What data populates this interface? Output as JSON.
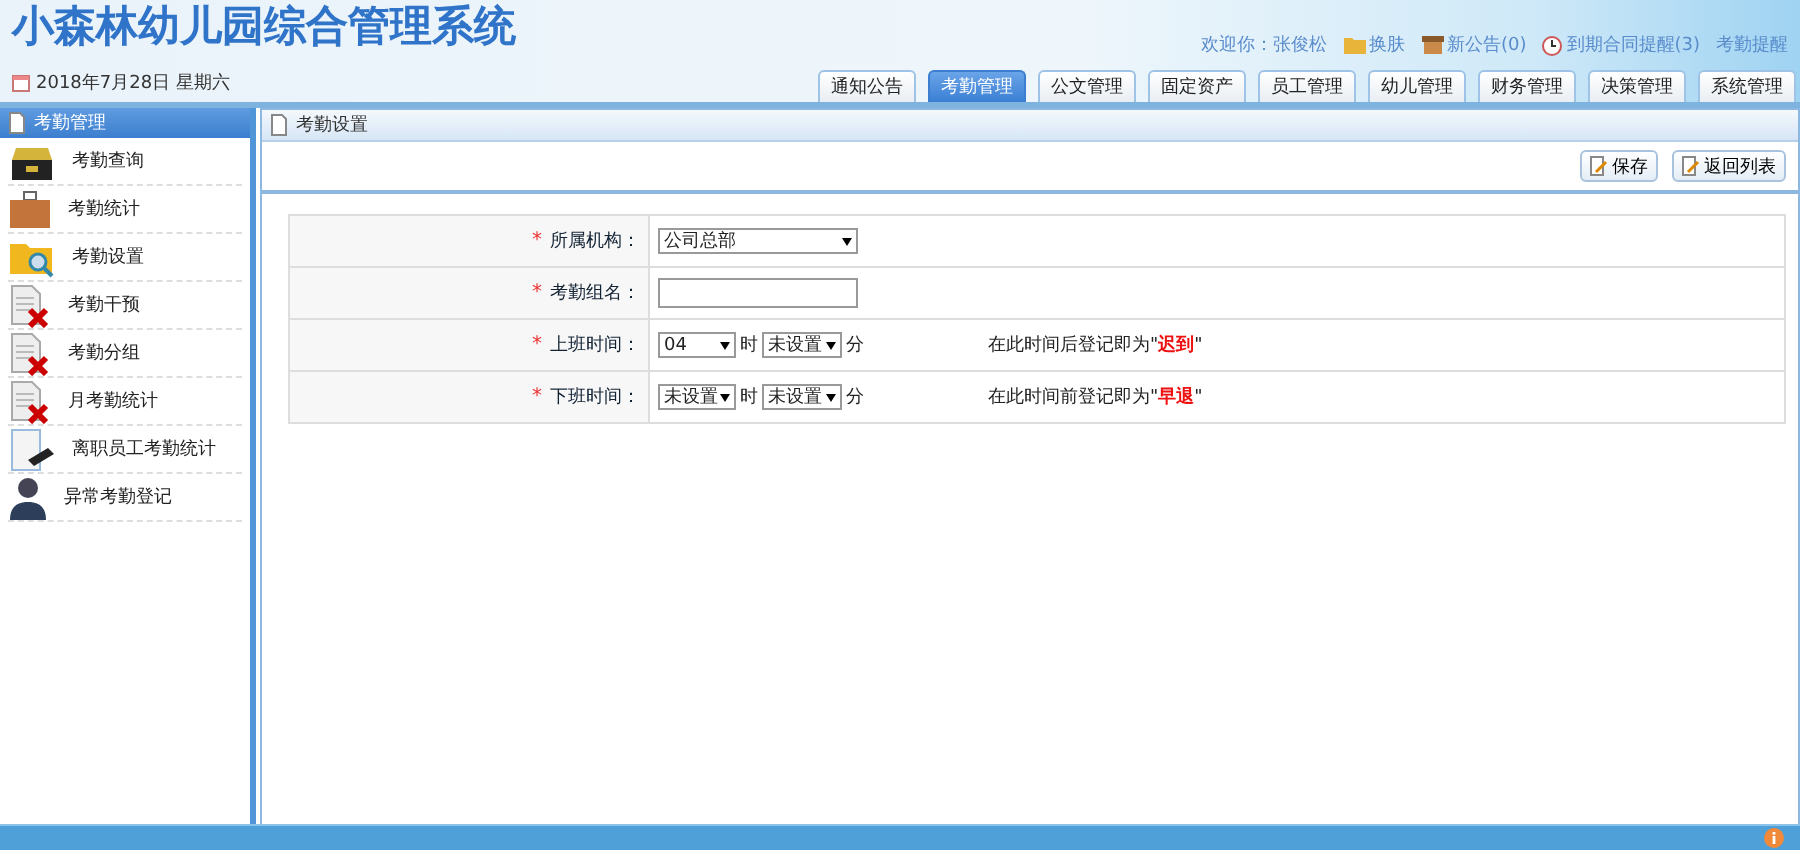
{
  "header": {
    "title": "小森林幼儿园综合管理系统",
    "date": "2018年7月28日 星期六",
    "welcome": "欢迎你：张俊松",
    "links": [
      {
        "kind": "skin",
        "label": "换肤"
      },
      {
        "kind": "notice",
        "label": "新公告(0)"
      },
      {
        "kind": "clock",
        "label": "到期合同提醒(3)"
      },
      {
        "kind": "plain",
        "label": "考勤提醒"
      }
    ]
  },
  "tabs": [
    {
      "label": "通知公告",
      "selected": false
    },
    {
      "label": "考勤管理",
      "selected": true
    },
    {
      "label": "公文管理",
      "selected": false
    },
    {
      "label": "固定资产",
      "selected": false
    },
    {
      "label": "员工管理",
      "selected": false
    },
    {
      "label": "幼儿管理",
      "selected": false
    },
    {
      "label": "财务管理",
      "selected": false
    },
    {
      "label": "决策管理",
      "selected": false
    },
    {
      "label": "系统管理",
      "selected": false
    }
  ],
  "sidebar": {
    "title": "考勤管理",
    "items": [
      {
        "kind": "drawer",
        "label": "考勤查询"
      },
      {
        "kind": "briefcase",
        "label": "考勤统计"
      },
      {
        "kind": "folder",
        "label": "考勤设置"
      },
      {
        "kind": "docx",
        "label": "考勤干预"
      },
      {
        "kind": "docx",
        "label": "考勤分组"
      },
      {
        "kind": "docx",
        "label": "月考勤统计"
      },
      {
        "kind": "docpen",
        "label": "离职员工考勤统计"
      },
      {
        "kind": "person",
        "label": "异常考勤登记"
      }
    ]
  },
  "panel": {
    "title": "考勤设置",
    "buttons": [
      "保存",
      "返回列表"
    ],
    "rows": [
      {
        "kind": "select",
        "required": "*",
        "label": "所属机构：",
        "value": "公司总部"
      },
      {
        "kind": "text",
        "required": "*",
        "label": "考勤组名："
      },
      {
        "kind": "time",
        "required": "*",
        "label": "上班时间：",
        "hour": "04",
        "hour_unit": "时",
        "minute": "未设置",
        "minute_unit": "分",
        "note": "在此时间后登记即为\"",
        "note_mark": "迟到",
        "note_end": "\""
      },
      {
        "kind": "time",
        "required": "*",
        "label": "下班时间：",
        "hour": "未设置",
        "hour_unit": "时",
        "minute": "未设置",
        "minute_unit": "分",
        "note": "在此时间前登记即为\"",
        "note_mark": "早退",
        "note_end": "\""
      }
    ]
  }
}
